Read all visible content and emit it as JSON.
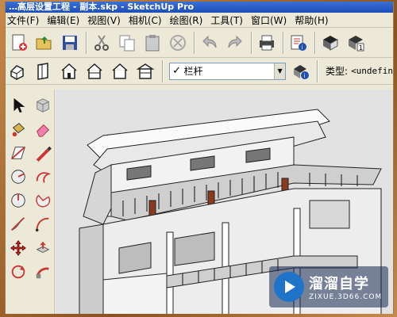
{
  "window": {
    "title": "…高层设置工程 - 副本.skp - SketchUp Pro"
  },
  "menu": {
    "items": [
      "文件(F)",
      "编辑(E)",
      "视图(V)",
      "相机(C)",
      "绘图(R)",
      "工具(T)",
      "窗口(W)",
      "帮助(H)"
    ]
  },
  "toolbar1": {
    "icons": [
      "new-file-icon",
      "open-file-icon",
      "save-icon",
      "cut-icon",
      "copy-icon",
      "paste-icon",
      "erase-icon",
      "undo-icon",
      "redo-icon",
      "print-icon",
      "model-info-icon",
      "add-scene-icon",
      "layer-1-icon"
    ]
  },
  "toolbar2": {
    "icons": [
      "iso-view-icon",
      "top-view-icon",
      "front-view-icon",
      "right-view-icon",
      "back-view-icon",
      "left-view-icon"
    ],
    "layer_check": "✓",
    "layer_value": "栏杆",
    "type_label": "类型:",
    "type_value": "<undefin"
  },
  "watermark": {
    "title": "溜溜自学",
    "url": "ZIXUE.3D66.COM"
  },
  "colors": {
    "title_bar": "#1d4fb8",
    "chrome": "#ece9d8",
    "viewport": "#e2e2e2",
    "frame": "#8b5220"
  }
}
